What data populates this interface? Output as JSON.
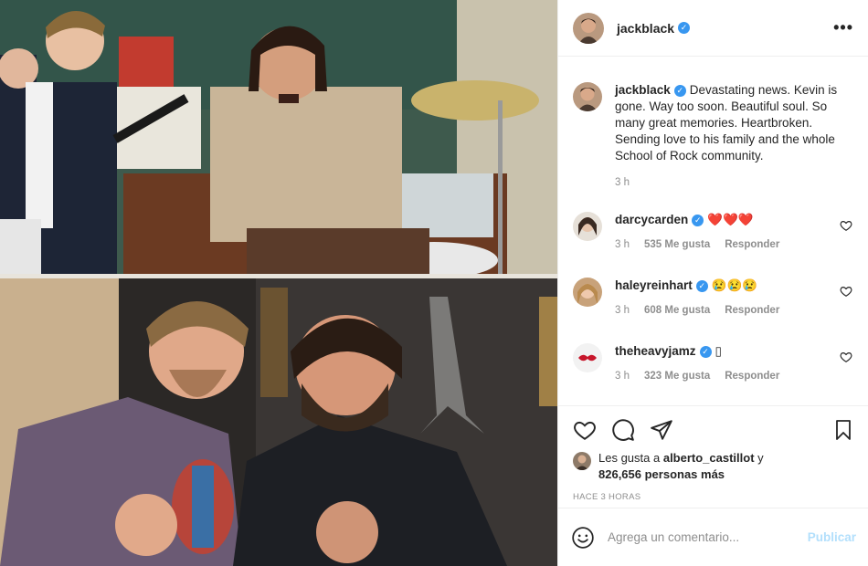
{
  "post": {
    "username": "jackblack",
    "caption": "Devastating news. Kevin is gone. Way too soon. Beautiful soul. So many great memories. Heartbroken. Sending love to his family and the whole School of Rock community.",
    "caption_time": "3 h",
    "more_icon": "•••"
  },
  "comments": [
    {
      "username": "darcycarden",
      "text": "❤️❤️❤️",
      "time": "3 h",
      "likes": "535 Me gusta",
      "reply": "Responder"
    },
    {
      "username": "haleyreinhart",
      "text": "😢😢😢",
      "time": "3 h",
      "likes": "608 Me gusta",
      "reply": "Responder"
    },
    {
      "username": "theheavyjamz",
      "text": "▯",
      "time": "3 h",
      "likes": "323 Me gusta",
      "reply": "Responder"
    }
  ],
  "likes": {
    "prefix": "Les gusta a",
    "user": "alberto_castillot",
    "conj": "y",
    "count": "826,656 personas más"
  },
  "timestamp": "HACE 3 HORAS",
  "add_comment": {
    "placeholder": "Agrega un comentario...",
    "post_label": "Publicar"
  },
  "icons": {
    "verified": "verified-badge",
    "like": "heart-icon",
    "comment": "comment-icon",
    "share": "share-icon",
    "save": "bookmark-icon",
    "emoji": "emoji-icon"
  },
  "colors": {
    "verified": "#3897f0",
    "muted": "#8e8e8e",
    "post_button": "#b2dffc"
  }
}
